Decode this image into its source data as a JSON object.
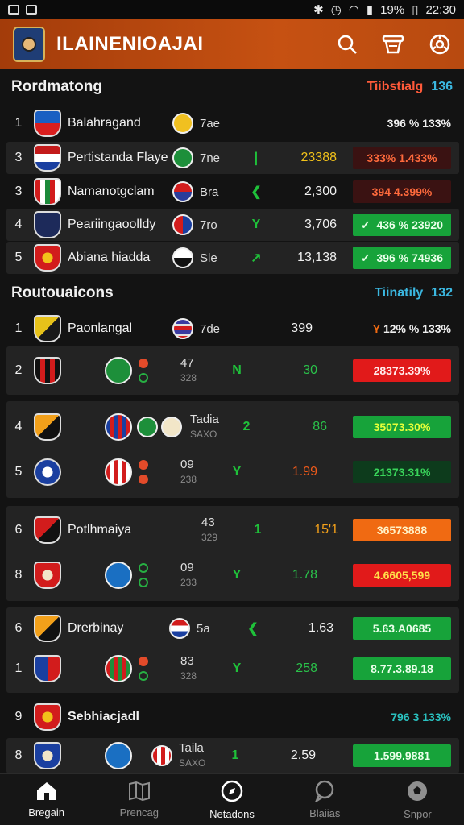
{
  "status": {
    "battery": "19%",
    "time": "22:30"
  },
  "appbar": {
    "title": "ILAINENIOAJAI",
    "icons": [
      "search-icon",
      "filter-icon",
      "settings-icon"
    ]
  },
  "section1": {
    "title": "Rordmatong",
    "right_label": "Tiibstialg",
    "right_value": "136",
    "rows": [
      {
        "rank": "1",
        "team": "Balahragand",
        "score": "7ae",
        "value": "396 % 133%"
      },
      {
        "rank": "3",
        "team": "Pertistanda Flaye",
        "score": "7ne",
        "value": "23388",
        "pill": "333% 1.433%"
      },
      {
        "rank": "3",
        "team": "Namanotgclam",
        "score": "Bra",
        "value": "2,300",
        "pill": "394 4.399%"
      },
      {
        "rank": "4",
        "team": "Peariingaoolldy",
        "score": "7ro",
        "value": "3,706",
        "pill": "436 % 23920"
      },
      {
        "rank": "5",
        "team": "Abiana hiadda",
        "score": "Sle",
        "value": "13,138",
        "pill": "396 % 74936"
      }
    ]
  },
  "section2": {
    "title": "Routouaicons",
    "right_label": "Tiinatily",
    "right_value": "132",
    "rows": [
      {
        "rank": "1",
        "team": "Paonlangal",
        "score": "7de",
        "value": "399",
        "pill": "12% % 133%"
      },
      {
        "rank": "2",
        "score": "47",
        "sub": "328",
        "trend": "N",
        "value": "30",
        "pill": "28373.39%"
      },
      {
        "rank": "4",
        "score": "Tadia",
        "sub": "SAXO",
        "trend": "2",
        "value": "86",
        "pill": "35073.30%"
      },
      {
        "rank": "5",
        "score": "09",
        "sub": "238",
        "trend": "Y",
        "value": "1.99",
        "pill": "21373.31%"
      },
      {
        "rank": "6",
        "team": "Potlhmaiya",
        "score": "43",
        "sub": "329",
        "trend": "1",
        "value": "15'1",
        "pill": "36573888"
      },
      {
        "rank": "8",
        "score": "09",
        "sub": "233",
        "trend": "Y",
        "value": "1.78",
        "pill": "4.6605,599"
      },
      {
        "rank": "6",
        "team": "Drerbinay",
        "score": "5a",
        "value": "1.63",
        "pill": "5.63.A0685"
      },
      {
        "rank": "1",
        "score": "83",
        "sub": "328",
        "trend": "Y",
        "value": "258",
        "pill": "8.77.3.89.18"
      }
    ]
  },
  "section3": {
    "rank": "9",
    "title": "Sebhiacjadl",
    "right": "796 3 133%",
    "row": {
      "rank": "8",
      "score": "Taila",
      "sub": "SAXO",
      "trend": "1",
      "value": "2.59",
      "pill": "1.599.9881"
    }
  },
  "nav": {
    "items": [
      {
        "label": "Bregain",
        "icon": "home-icon"
      },
      {
        "label": "Prencag",
        "icon": "map-icon"
      },
      {
        "label": "Netadons",
        "icon": "compass-icon"
      },
      {
        "label": "Blaiias",
        "icon": "chat-icon"
      },
      {
        "label": "Snpor",
        "icon": "soccer-ball-icon"
      }
    ]
  },
  "colors": {
    "accent": "#c65112",
    "positive": "#17a33a",
    "negative": "#e11a1a",
    "orange": "#f06a12"
  }
}
